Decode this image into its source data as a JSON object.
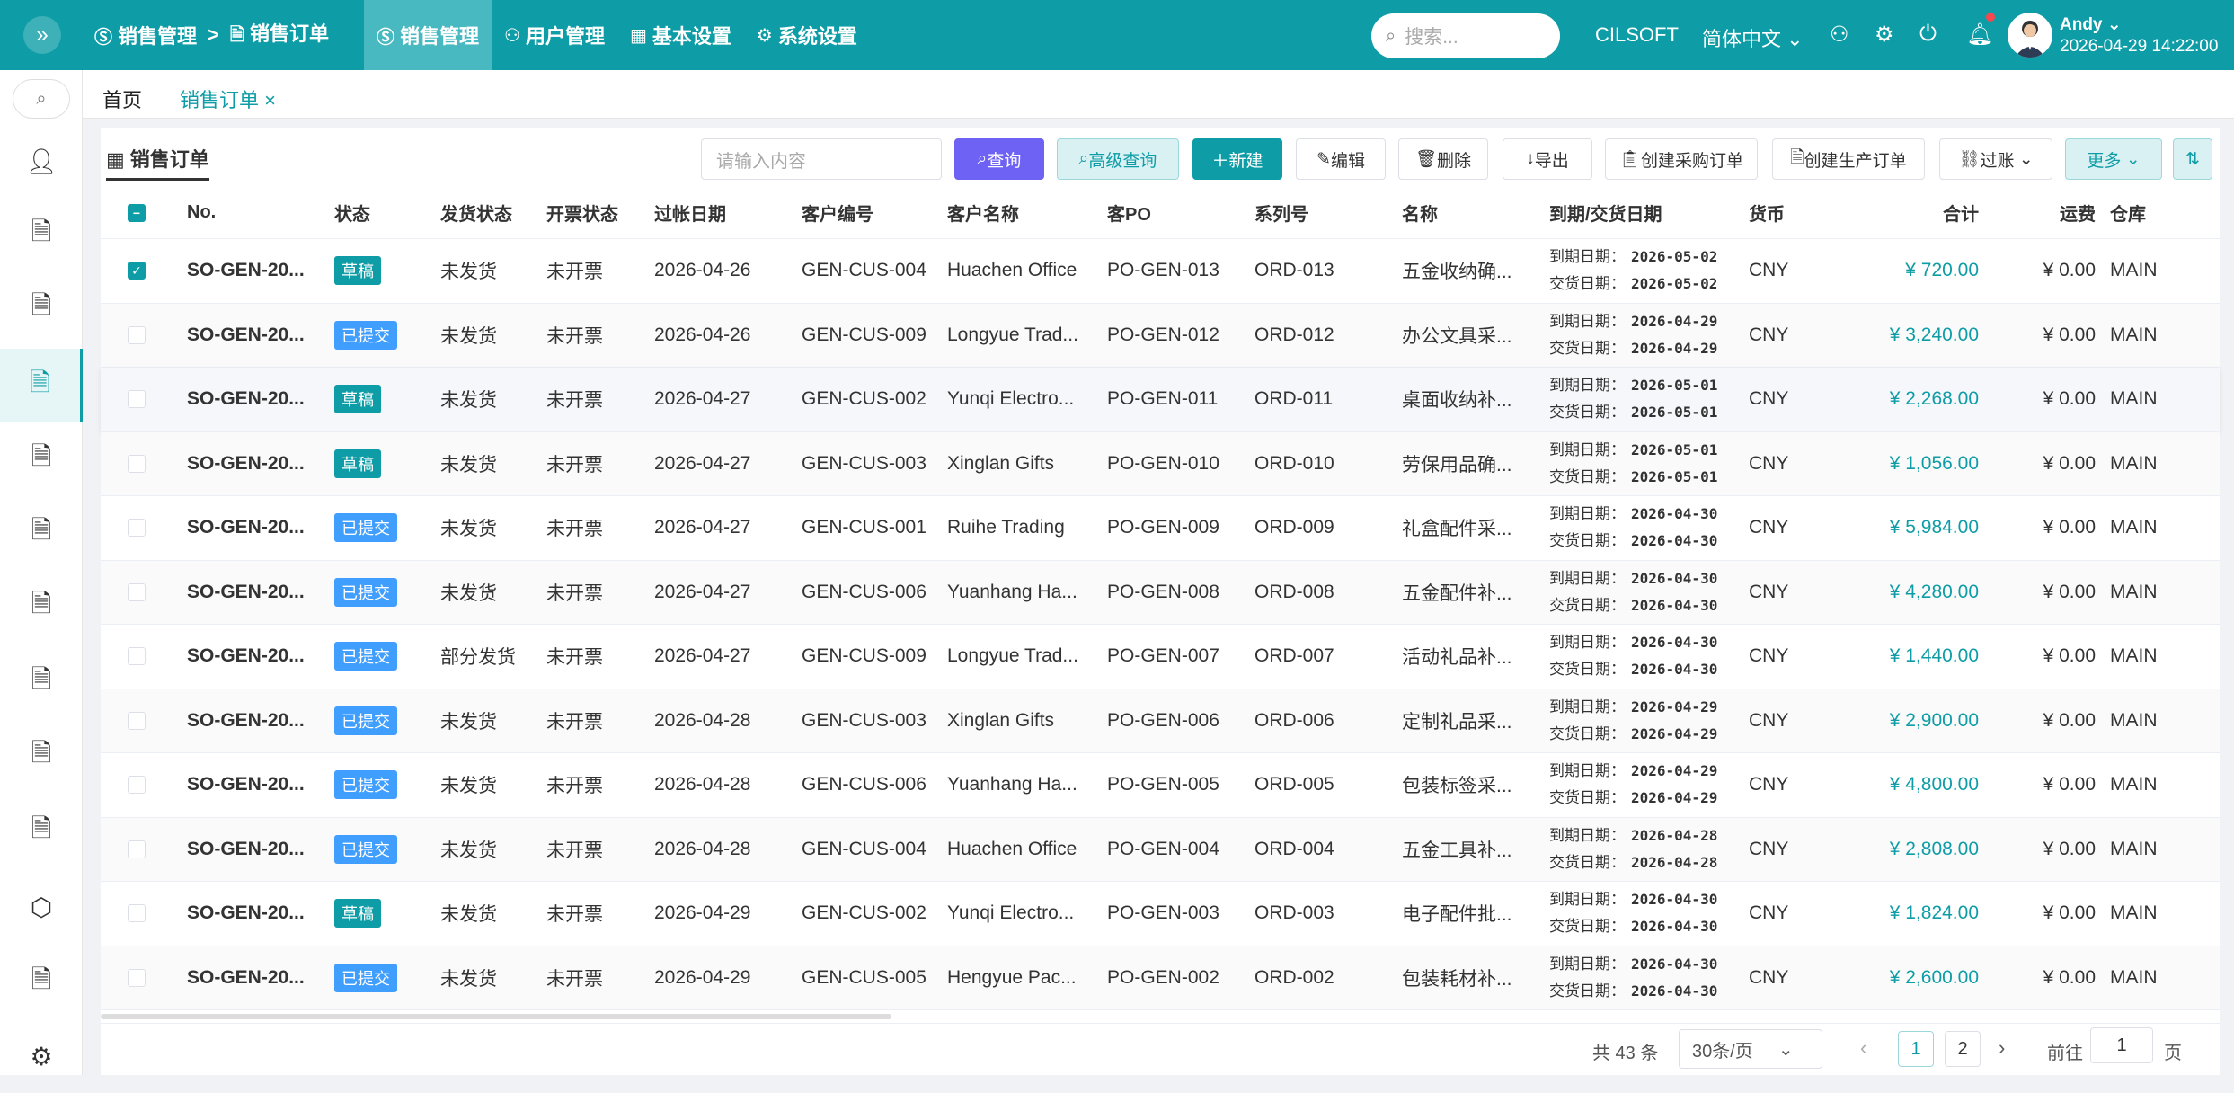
{
  "topbar": {
    "breadcrumb": [
      "销售管理",
      "销售订单"
    ],
    "breadcrumb_sep": ">",
    "nav": [
      "销售管理",
      "用户管理",
      "基本设置",
      "系统设置"
    ],
    "search_placeholder": "搜索...",
    "brand": "CILSOFT",
    "language": "简体中文",
    "user_name": "Andy",
    "datetime": "2026-04-29 14:22:00"
  },
  "tabs": {
    "home": "首页",
    "current": "销售订单",
    "close": "×"
  },
  "panel": {
    "title": "销售订单"
  },
  "toolbar": {
    "input_placeholder": "请输入内容",
    "query": "查询",
    "advanced": "高级查询",
    "new": "新建",
    "edit": "编辑",
    "delete": "删除",
    "export": "导出",
    "create_po": "创建采购订单",
    "create_mo": "创建生产订单",
    "post": "过账",
    "more": "更多"
  },
  "table": {
    "headers": [
      "No.",
      "状态",
      "发货状态",
      "开票状态",
      "过帐日期",
      "客户编号",
      "客户名称",
      "客PO",
      "系列号",
      "名称",
      "到期/交货日期",
      "货币",
      "合计",
      "运费",
      "仓库"
    ],
    "due_label": "到期日期：",
    "delivery_label": "交货日期：",
    "rows": [
      {
        "no": "SO-GEN-20...",
        "status": "草稿",
        "ship": "未发货",
        "inv": "未开票",
        "date": "2026-04-26",
        "cust_no": "GEN-CUS-004",
        "cust": "Huachen Office",
        "po": "PO-GEN-013",
        "series": "ORD-013",
        "name": "五金收纳确...",
        "due": "2026-05-02",
        "deliv": "2026-05-02",
        "cur": "CNY",
        "total": "¥ 720.00",
        "freight": "¥ 0.00",
        "wh": "MAIN",
        "checked": true
      },
      {
        "no": "SO-GEN-20...",
        "status": "已提交",
        "ship": "未发货",
        "inv": "未开票",
        "date": "2026-04-26",
        "cust_no": "GEN-CUS-009",
        "cust": "Longyue Trad...",
        "po": "PO-GEN-012",
        "series": "ORD-012",
        "name": "办公文具采...",
        "due": "2026-04-29",
        "deliv": "2026-04-29",
        "cur": "CNY",
        "total": "¥ 3,240.00",
        "freight": "¥ 0.00",
        "wh": "MAIN",
        "checked": false
      },
      {
        "no": "SO-GEN-20...",
        "status": "草稿",
        "ship": "未发货",
        "inv": "未开票",
        "date": "2026-04-27",
        "cust_no": "GEN-CUS-002",
        "cust": "Yunqi Electro...",
        "po": "PO-GEN-011",
        "series": "ORD-011",
        "name": "桌面收纳补...",
        "due": "2026-05-01",
        "deliv": "2026-05-01",
        "cur": "CNY",
        "total": "¥ 2,268.00",
        "freight": "¥ 0.00",
        "wh": "MAIN",
        "checked": false
      },
      {
        "no": "SO-GEN-20...",
        "status": "草稿",
        "ship": "未发货",
        "inv": "未开票",
        "date": "2026-04-27",
        "cust_no": "GEN-CUS-003",
        "cust": "Xinglan Gifts",
        "po": "PO-GEN-010",
        "series": "ORD-010",
        "name": "劳保用品确...",
        "due": "2026-05-01",
        "deliv": "2026-05-01",
        "cur": "CNY",
        "total": "¥ 1,056.00",
        "freight": "¥ 0.00",
        "wh": "MAIN",
        "checked": false
      },
      {
        "no": "SO-GEN-20...",
        "status": "已提交",
        "ship": "未发货",
        "inv": "未开票",
        "date": "2026-04-27",
        "cust_no": "GEN-CUS-001",
        "cust": "Ruihe Trading",
        "po": "PO-GEN-009",
        "series": "ORD-009",
        "name": "礼盒配件采...",
        "due": "2026-04-30",
        "deliv": "2026-04-30",
        "cur": "CNY",
        "total": "¥ 5,984.00",
        "freight": "¥ 0.00",
        "wh": "MAIN",
        "checked": false
      },
      {
        "no": "SO-GEN-20...",
        "status": "已提交",
        "ship": "未发货",
        "inv": "未开票",
        "date": "2026-04-27",
        "cust_no": "GEN-CUS-006",
        "cust": "Yuanhang Ha...",
        "po": "PO-GEN-008",
        "series": "ORD-008",
        "name": "五金配件补...",
        "due": "2026-04-30",
        "deliv": "2026-04-30",
        "cur": "CNY",
        "total": "¥ 4,280.00",
        "freight": "¥ 0.00",
        "wh": "MAIN",
        "checked": false
      },
      {
        "no": "SO-GEN-20...",
        "status": "已提交",
        "ship": "部分发货",
        "inv": "未开票",
        "date": "2026-04-27",
        "cust_no": "GEN-CUS-009",
        "cust": "Longyue Trad...",
        "po": "PO-GEN-007",
        "series": "ORD-007",
        "name": "活动礼品补...",
        "due": "2026-04-30",
        "deliv": "2026-04-30",
        "cur": "CNY",
        "total": "¥ 1,440.00",
        "freight": "¥ 0.00",
        "wh": "MAIN",
        "checked": false
      },
      {
        "no": "SO-GEN-20...",
        "status": "已提交",
        "ship": "未发货",
        "inv": "未开票",
        "date": "2026-04-28",
        "cust_no": "GEN-CUS-003",
        "cust": "Xinglan Gifts",
        "po": "PO-GEN-006",
        "series": "ORD-006",
        "name": "定制礼品采...",
        "due": "2026-04-29",
        "deliv": "2026-04-29",
        "cur": "CNY",
        "total": "¥ 2,900.00",
        "freight": "¥ 0.00",
        "wh": "MAIN",
        "checked": false
      },
      {
        "no": "SO-GEN-20...",
        "status": "已提交",
        "ship": "未发货",
        "inv": "未开票",
        "date": "2026-04-28",
        "cust_no": "GEN-CUS-006",
        "cust": "Yuanhang Ha...",
        "po": "PO-GEN-005",
        "series": "ORD-005",
        "name": "包装标签采...",
        "due": "2026-04-29",
        "deliv": "2026-04-29",
        "cur": "CNY",
        "total": "¥ 4,800.00",
        "freight": "¥ 0.00",
        "wh": "MAIN",
        "checked": false
      },
      {
        "no": "SO-GEN-20...",
        "status": "已提交",
        "ship": "未发货",
        "inv": "未开票",
        "date": "2026-04-28",
        "cust_no": "GEN-CUS-004",
        "cust": "Huachen Office",
        "po": "PO-GEN-004",
        "series": "ORD-004",
        "name": "五金工具补...",
        "due": "2026-04-28",
        "deliv": "2026-04-28",
        "cur": "CNY",
        "total": "¥ 2,808.00",
        "freight": "¥ 0.00",
        "wh": "MAIN",
        "checked": false
      },
      {
        "no": "SO-GEN-20...",
        "status": "草稿",
        "ship": "未发货",
        "inv": "未开票",
        "date": "2026-04-29",
        "cust_no": "GEN-CUS-002",
        "cust": "Yunqi Electro...",
        "po": "PO-GEN-003",
        "series": "ORD-003",
        "name": "电子配件批...",
        "due": "2026-04-30",
        "deliv": "2026-04-30",
        "cur": "CNY",
        "total": "¥ 1,824.00",
        "freight": "¥ 0.00",
        "wh": "MAIN",
        "checked": false
      },
      {
        "no": "SO-GEN-20...",
        "status": "已提交",
        "ship": "未发货",
        "inv": "未开票",
        "date": "2026-04-29",
        "cust_no": "GEN-CUS-005",
        "cust": "Hengyue Pac...",
        "po": "PO-GEN-002",
        "series": "ORD-002",
        "name": "包装耗材补...",
        "due": "2026-04-30",
        "deliv": "2026-04-30",
        "cur": "CNY",
        "total": "¥ 2,600.00",
        "freight": "¥ 0.00",
        "wh": "MAIN",
        "checked": false
      }
    ]
  },
  "pager": {
    "total": "共 43 条",
    "page_size": "30条/页",
    "pages": [
      "1",
      "2"
    ],
    "goto_label": "前往",
    "goto_value": "1",
    "page_unit": "页"
  },
  "colors": {
    "primary": "#0e9da6",
    "query": "#6e62f5",
    "submitted": "#409eff"
  }
}
